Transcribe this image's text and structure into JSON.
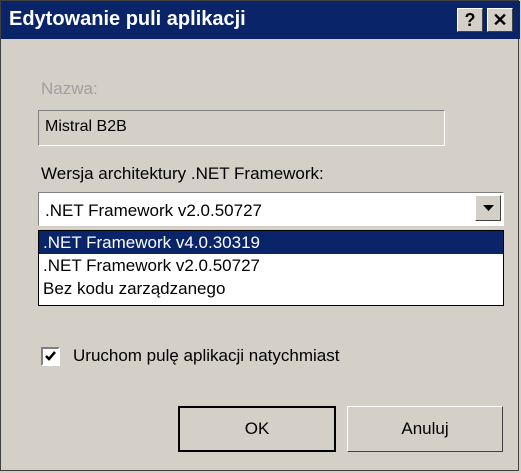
{
  "window": {
    "title": "Edytowanie puli aplikacji",
    "help_label": "?",
    "close_label": "✕"
  },
  "name": {
    "label": "Nazwa:",
    "value": "Mistral B2B"
  },
  "framework": {
    "label": "Wersja architektury .NET Framework:",
    "selected": ".NET Framework v2.0.50727",
    "options": [
      ".NET Framework v4.0.30319",
      ".NET Framework v2.0.50727",
      "Bez kodu zarządzanego"
    ]
  },
  "start_immediately": {
    "label": "Uruchom pulę aplikacji natychmiast",
    "checked": true
  },
  "buttons": {
    "ok": "OK",
    "cancel": "Anuluj"
  }
}
